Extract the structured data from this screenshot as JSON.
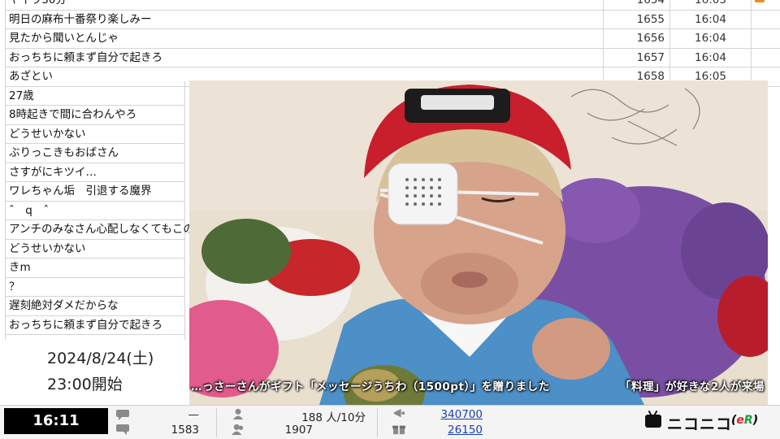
{
  "comments": [
    {
      "text": "ヤイラ30分",
      "no": "1654",
      "time": "16:03",
      "flag": true
    },
    {
      "text": "明日の麻布十番祭り楽しみー",
      "no": "1655",
      "time": "16:04",
      "flag": false
    },
    {
      "text": "見たから聞いとんじゃ",
      "no": "1656",
      "time": "16:04",
      "flag": false
    },
    {
      "text": "おっちちに頼まず自分で起きろ",
      "no": "1657",
      "time": "16:04",
      "flag": false
    },
    {
      "text": "あざとい",
      "no": "1658",
      "time": "16:05",
      "flag": false
    },
    {
      "text": "27歳",
      "no": "",
      "time": "",
      "flag": false
    },
    {
      "text": "8時起きで間に合わんやろ",
      "no": "",
      "time": "",
      "flag": false
    },
    {
      "text": "どうせいかない",
      "no": "",
      "time": "",
      "flag": false
    },
    {
      "text": "ぶりっこきもおばさん",
      "no": "",
      "time": "",
      "flag": false
    },
    {
      "text": "さすがにキツイ…",
      "no": "",
      "time": "",
      "flag": false
    },
    {
      "text": "ワレちゃん垢　引退する魔界",
      "no": "",
      "time": "",
      "flag": false
    },
    {
      "text": "ˆ　q　ˆ",
      "no": "",
      "time": "",
      "flag": false
    },
    {
      "text": "アンチのみなさん心配しなくてもこの子",
      "no": "",
      "time": "",
      "flag": false
    },
    {
      "text": "どうせいかない",
      "no": "",
      "time": "",
      "flag": false
    },
    {
      "text": "きm",
      "no": "",
      "time": "",
      "flag": false
    },
    {
      "text": "？",
      "no": "",
      "time": "",
      "flag": false
    },
    {
      "text": "遅刻絶対ダメだからな",
      "no": "",
      "time": "",
      "flag": false
    },
    {
      "text": "おっちちに頼まず自分で起きろ",
      "no": "",
      "time": "",
      "flag": false
    }
  ],
  "video": {
    "gift_message": "…っさーさんがギフト「メッセージうちわ（1500pt）」を贈りました",
    "visitor_message": "「料理」が好きな2人が来場"
  },
  "info": {
    "date": "2024/8/24(土)",
    "start": "23:00開始"
  },
  "statusbar": {
    "clock": "16:11",
    "comment_rate": "—",
    "comment_total": "1583",
    "viewer_rate": "188 人/10分",
    "viewer_total": "1907",
    "gift_points": "340700",
    "ad_points": "26150",
    "icons": [
      "comment-icon",
      "person-icon",
      "gift-icon"
    ],
    "logo_text": "ニコニコ",
    "logo_suffix_e": "e",
    "logo_suffix_r": "R"
  },
  "colors": {
    "flag": "#f28b1e",
    "link": "#1a3fb8",
    "clock_bg": "#000000",
    "logo_e": "#e0262e",
    "logo_r": "#1b9e3b"
  }
}
